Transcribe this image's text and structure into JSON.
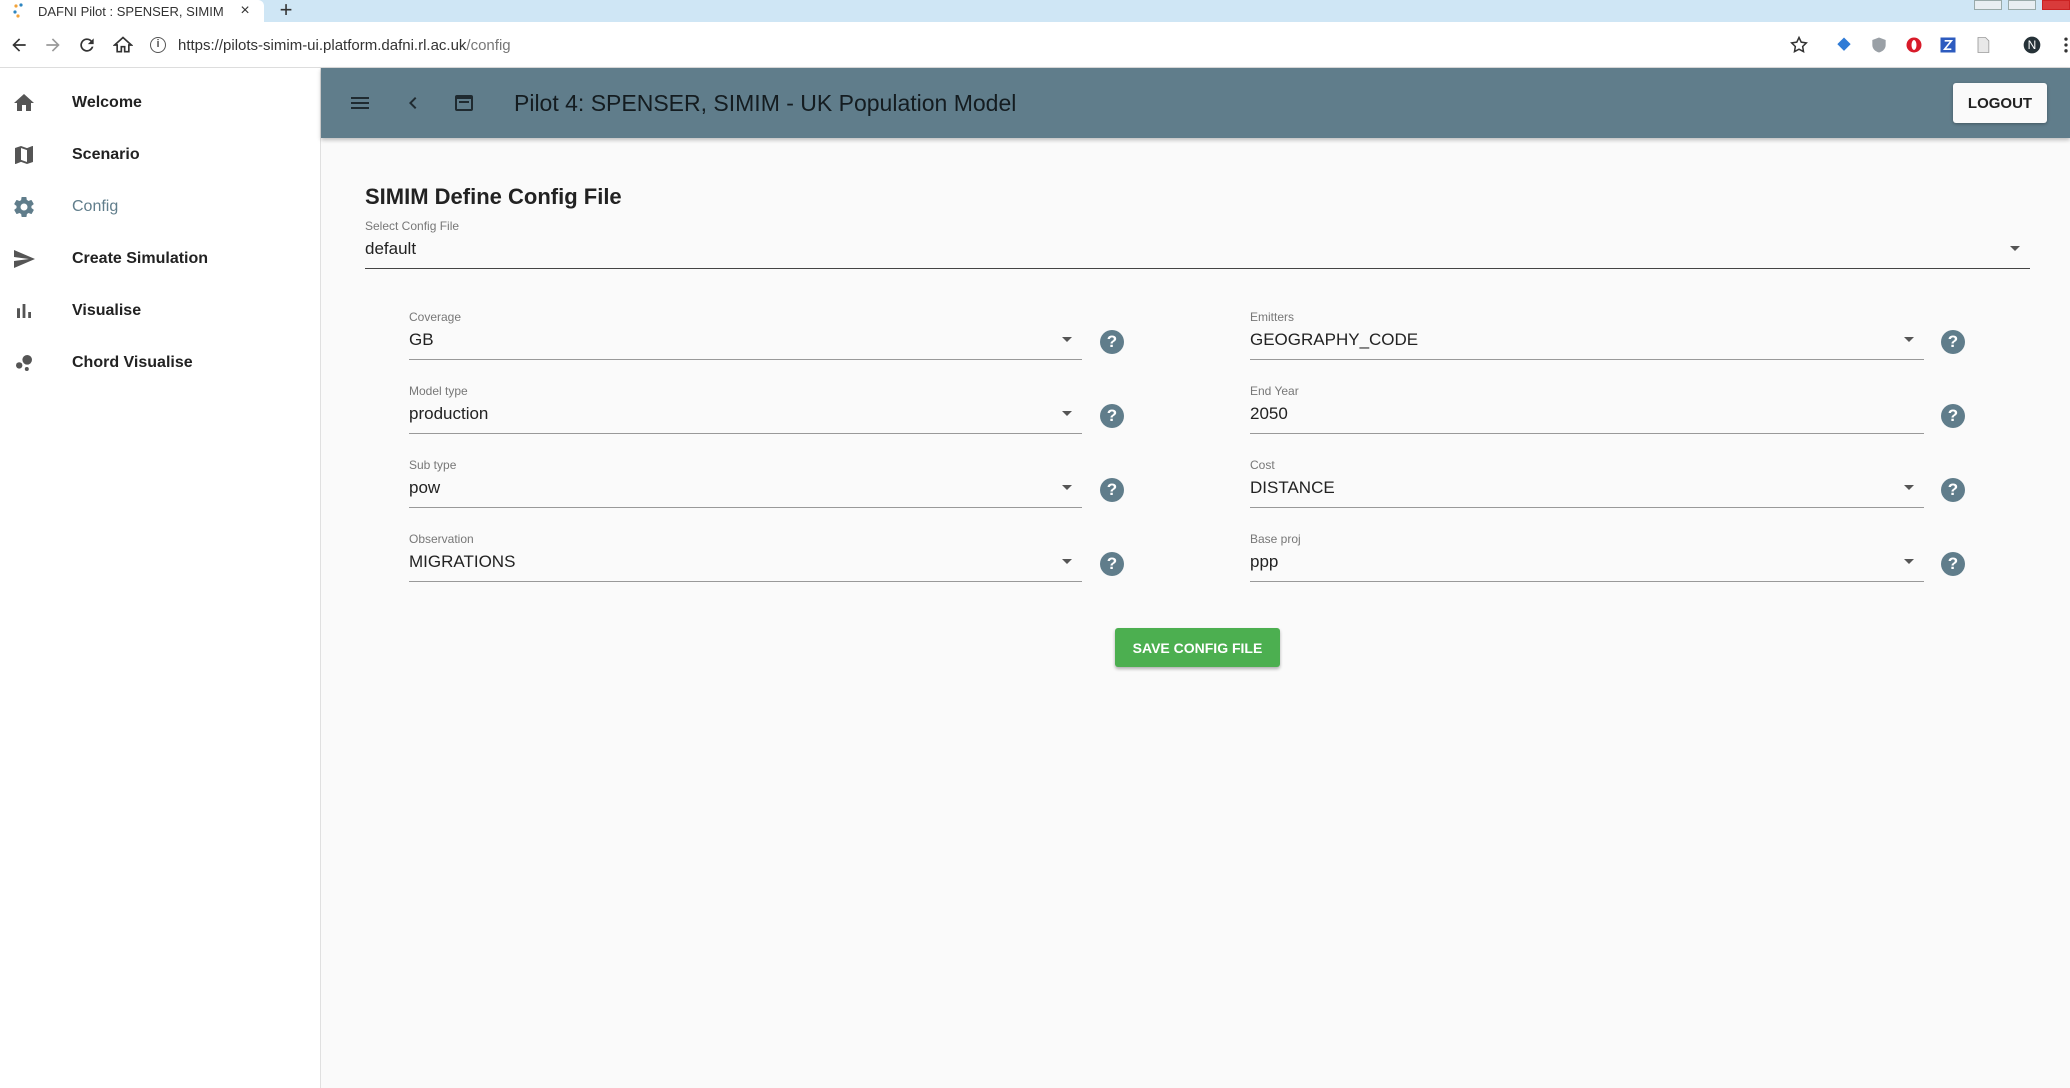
{
  "browser": {
    "tab_title": "DAFNI Pilot : SPENSER, SIMIM",
    "url_host": "https://pilots-simim-ui.platform.dafni.rl.ac.uk",
    "url_path": "/config",
    "profile_initial": "N"
  },
  "sidebar": {
    "items": [
      {
        "label": "Welcome",
        "icon": "home-icon"
      },
      {
        "label": "Scenario",
        "icon": "map-icon"
      },
      {
        "label": "Config",
        "icon": "gear-icon"
      },
      {
        "label": "Create Simulation",
        "icon": "send-icon"
      },
      {
        "label": "Visualise",
        "icon": "bar-chart-icon"
      },
      {
        "label": "Chord Visualise",
        "icon": "bubble-chart-icon"
      }
    ],
    "active_item": "Config"
  },
  "appbar": {
    "title": "Pilot 4: SPENSER, SIMIM - UK Population Model",
    "logout_label": "LOGOUT",
    "color": "#607d8b"
  },
  "main": {
    "title": "SIMIM Define Config File",
    "config_select": {
      "label": "Select Config File",
      "value": "default"
    },
    "fields": {
      "coverage": {
        "label": "Coverage",
        "value": "GB"
      },
      "model_type": {
        "label": "Model type",
        "value": "production"
      },
      "sub_type": {
        "label": "Sub type",
        "value": "pow"
      },
      "observation": {
        "label": "Observation",
        "value": "MIGRATIONS"
      },
      "emitters": {
        "label": "Emitters",
        "value": "GEOGRAPHY_CODE"
      },
      "end_year": {
        "label": "End Year",
        "value": "2050"
      },
      "cost": {
        "label": "Cost",
        "value": "DISTANCE"
      },
      "base_proj": {
        "label": "Base proj",
        "value": "ppp"
      }
    },
    "help_glyph": "?",
    "save_label": "SAVE CONFIG FILE",
    "save_color": "#4caf50"
  }
}
